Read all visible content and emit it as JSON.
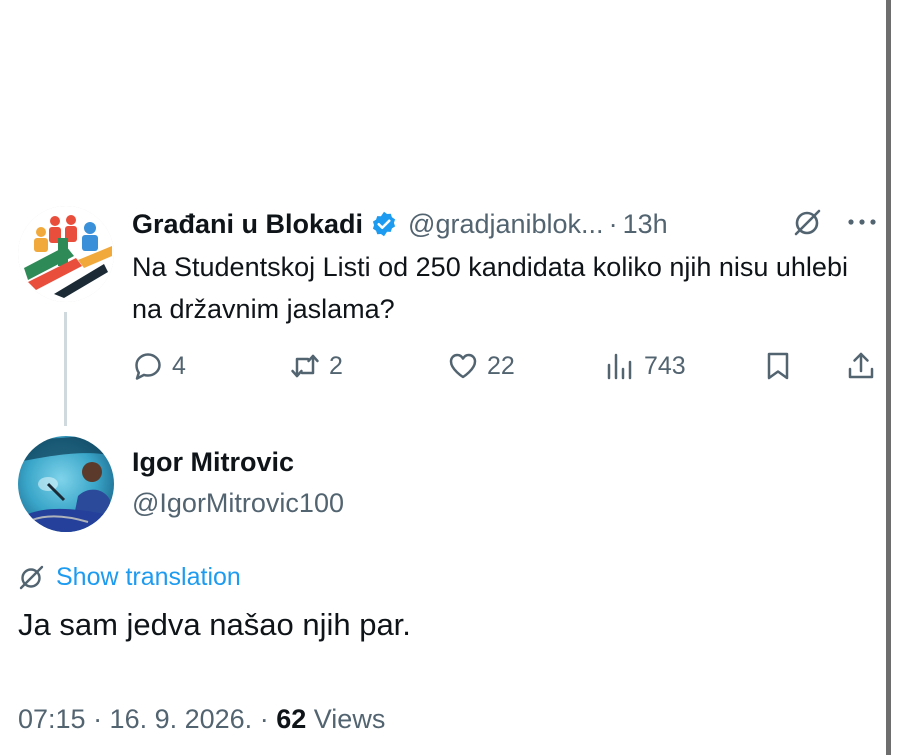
{
  "parent_tweet": {
    "author_name": "Građani u Blokadi",
    "handle": "@gradjaniblok...",
    "separator": "·",
    "time": "13h",
    "text": "Na Studentskoj Listi od 250 kandidata koliko njih nisu uhlebi na državnim jaslama?",
    "actions": {
      "replies": "4",
      "reposts": "2",
      "likes": "22",
      "views": "743"
    },
    "icons": [
      "verified-badge-icon",
      "translate-icon",
      "more-icon",
      "reply-icon",
      "repost-icon",
      "like-icon",
      "views-icon",
      "bookmark-icon",
      "share-icon"
    ]
  },
  "reply_tweet": {
    "author_name": "Igor Mitrovic",
    "handle": "@IgorMitrovic100",
    "show_translation": "Show translation",
    "text": "Ja sam jedva našao njih par.",
    "timestamp": "07:15 · 16. 9. 2026.",
    "separator": "·",
    "views_count": "62",
    "views_label": "Views"
  },
  "colors": {
    "text": "#0f1419",
    "secondary": "#536471",
    "accent": "#1d9bf0",
    "thread_line": "#cfd9de"
  }
}
